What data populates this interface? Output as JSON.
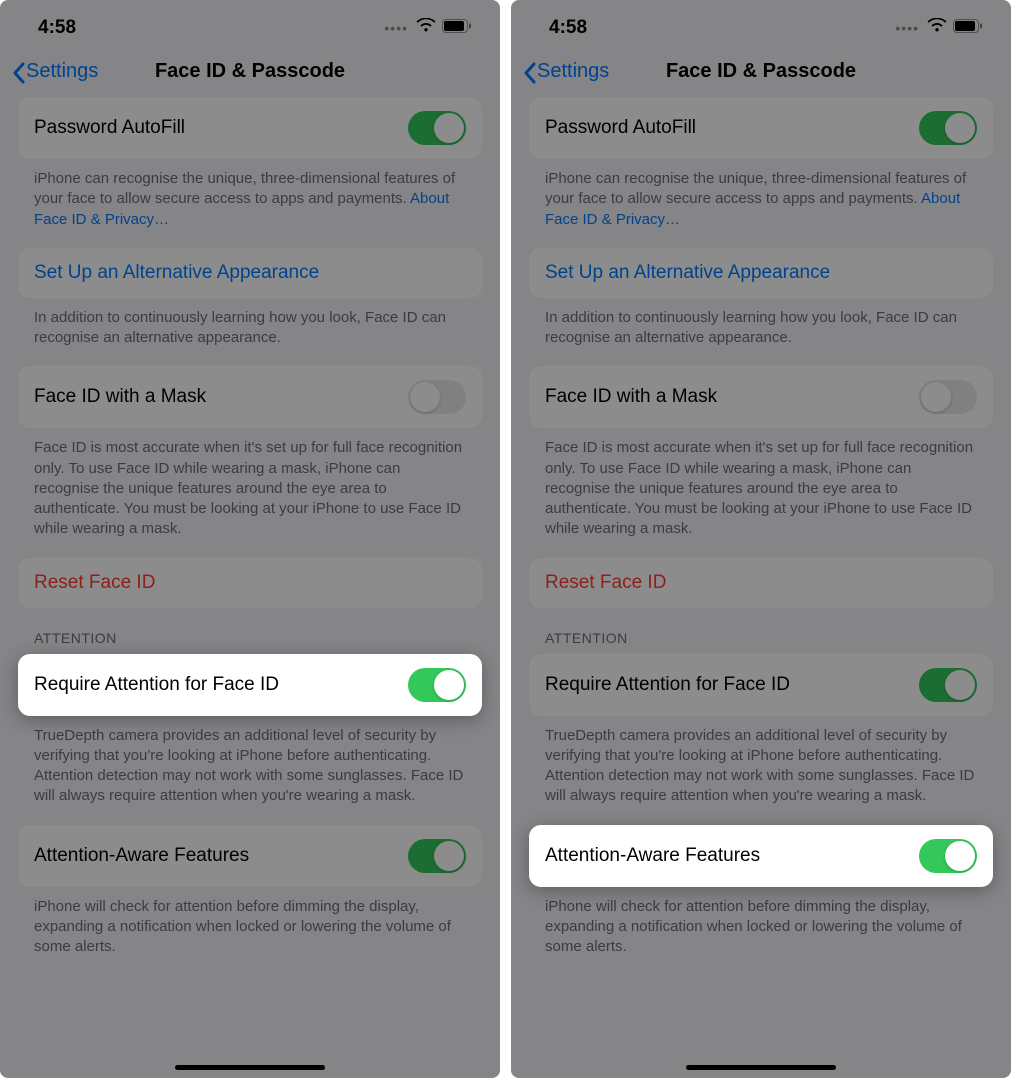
{
  "status": {
    "time": "4:58"
  },
  "nav": {
    "back": "Settings",
    "title": "Face ID & Passcode"
  },
  "rows": {
    "autofill": {
      "label": "Password AutoFill"
    },
    "autofill_footer_a": "iPhone can recognise the unique, three-dimensional features of your face to allow secure access to apps and payments. ",
    "autofill_footer_link": "About Face ID & Privacy…",
    "alt_appearance": {
      "label": "Set Up an Alternative Appearance"
    },
    "alt_footer": "In addition to continuously learning how you look, Face ID can recognise an alternative appearance.",
    "mask": {
      "label": "Face ID with a Mask"
    },
    "mask_footer": "Face ID is most accurate when it's set up for full face recognition only. To use Face ID while wearing a mask, iPhone can recognise the unique features around the eye area to authenticate. You must be looking at your iPhone to use Face ID while wearing a mask.",
    "reset": {
      "label": "Reset Face ID"
    },
    "attention_header": "ATTENTION",
    "require_attention": {
      "label": "Require Attention for Face ID"
    },
    "require_footer": "TrueDepth camera provides an additional level of security by verifying that you're looking at iPhone before authenticating. Attention detection may not work with some sunglasses. Face ID will always require attention when you're wearing a mask.",
    "aware": {
      "label": "Attention-Aware Features"
    },
    "aware_footer": "iPhone will check for attention before dimming the display, expanding a notification when locked or lowering the volume of some alerts."
  }
}
